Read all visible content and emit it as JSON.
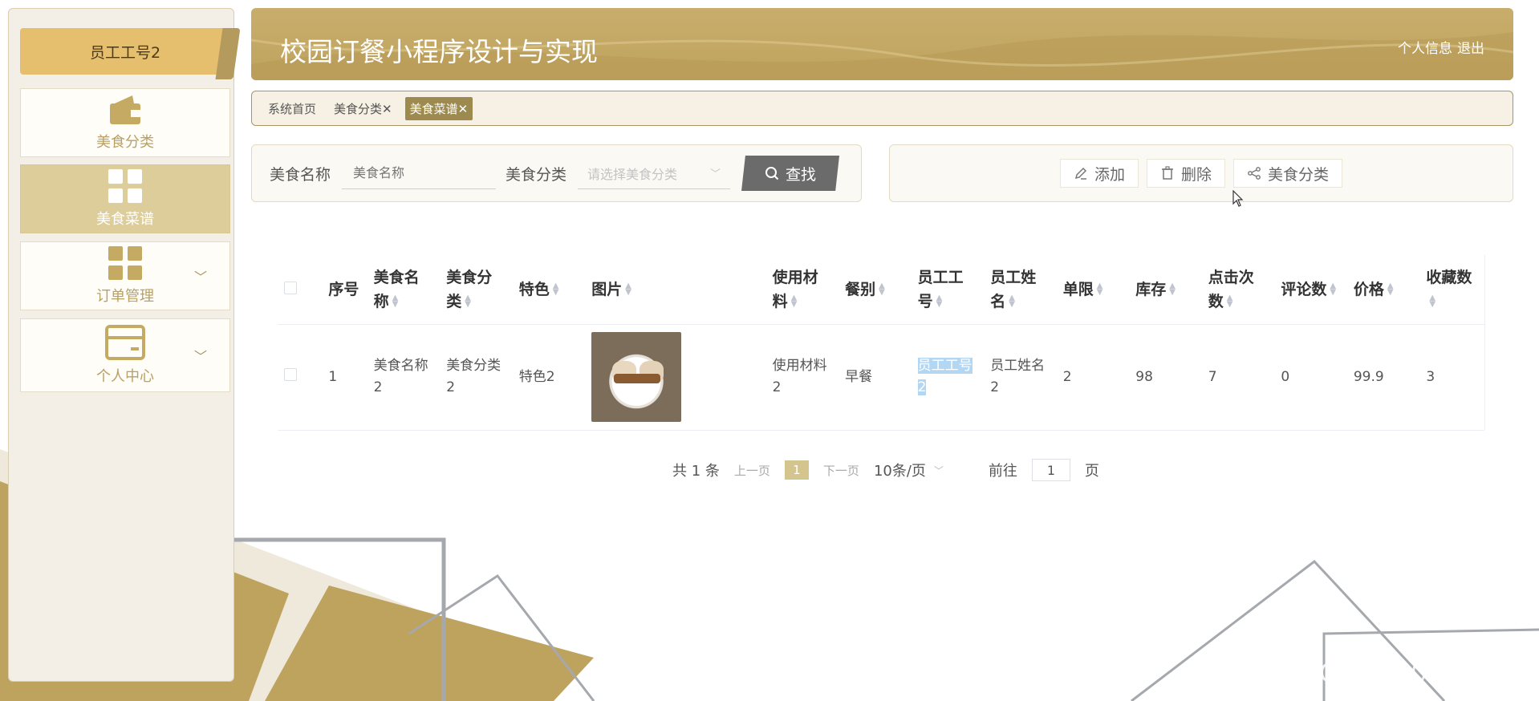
{
  "sidebar": {
    "user_label": "员工工号2",
    "items": [
      {
        "label": "美食分类",
        "icon": "wallet-icon",
        "active": false
      },
      {
        "label": "美食菜谱",
        "icon": "grid-icon",
        "active": true
      },
      {
        "label": "订单管理",
        "icon": "grid-icon",
        "active": false,
        "expandable": true
      },
      {
        "label": "个人中心",
        "icon": "card-icon",
        "active": false,
        "expandable": true
      }
    ]
  },
  "header": {
    "title": "校园订餐小程序设计与实现",
    "profile_link": "个人信息",
    "logout_link": "退出"
  },
  "tabs": [
    {
      "label": "系统首页",
      "closable": false,
      "active": false
    },
    {
      "label": "美食分类",
      "closable": true,
      "active": false
    },
    {
      "label": "美食菜谱",
      "closable": true,
      "active": true
    }
  ],
  "search": {
    "name_label": "美食名称",
    "name_placeholder": "美食名称",
    "category_label": "美食分类",
    "category_placeholder": "请选择美食分类",
    "search_button": "查找"
  },
  "actions": {
    "add": "添加",
    "delete": "删除",
    "category": "美食分类"
  },
  "table": {
    "headers": {
      "index": "序号",
      "name": "美食名称",
      "category": "美食分类",
      "feature": "特色",
      "image": "图片",
      "material": "使用材料",
      "meal": "餐别",
      "staff_id": "员工工号",
      "staff_name": "员工姓名",
      "limit": "单限",
      "stock": "库存",
      "clicks": "点击次数",
      "comments": "评论数",
      "price": "价格",
      "favorites": "收藏数"
    },
    "rows": [
      {
        "index": "1",
        "name": "美食名称2",
        "category": "美食分类2",
        "feature": "特色2",
        "material": "使用材料2",
        "meal": "早餐",
        "staff_id": "员工工号2",
        "staff_name": "员工姓名2",
        "limit": "2",
        "stock": "98",
        "clicks": "7",
        "comments": "0",
        "price": "99.9",
        "favorites": "3"
      }
    ]
  },
  "pagination": {
    "total": "共 1 条",
    "prev": "上一页",
    "current": "1",
    "next": "下一页",
    "page_size": "10条/页",
    "goto_label": "前往",
    "goto_value": "1",
    "page_unit": "页"
  },
  "watermark": "CSDN @QQ1980691580",
  "colors": {
    "accent": "#bea35e",
    "active_menu": "#dccd9b",
    "active_tab": "#9c8a4f",
    "search_button": "#6b6b6b"
  }
}
